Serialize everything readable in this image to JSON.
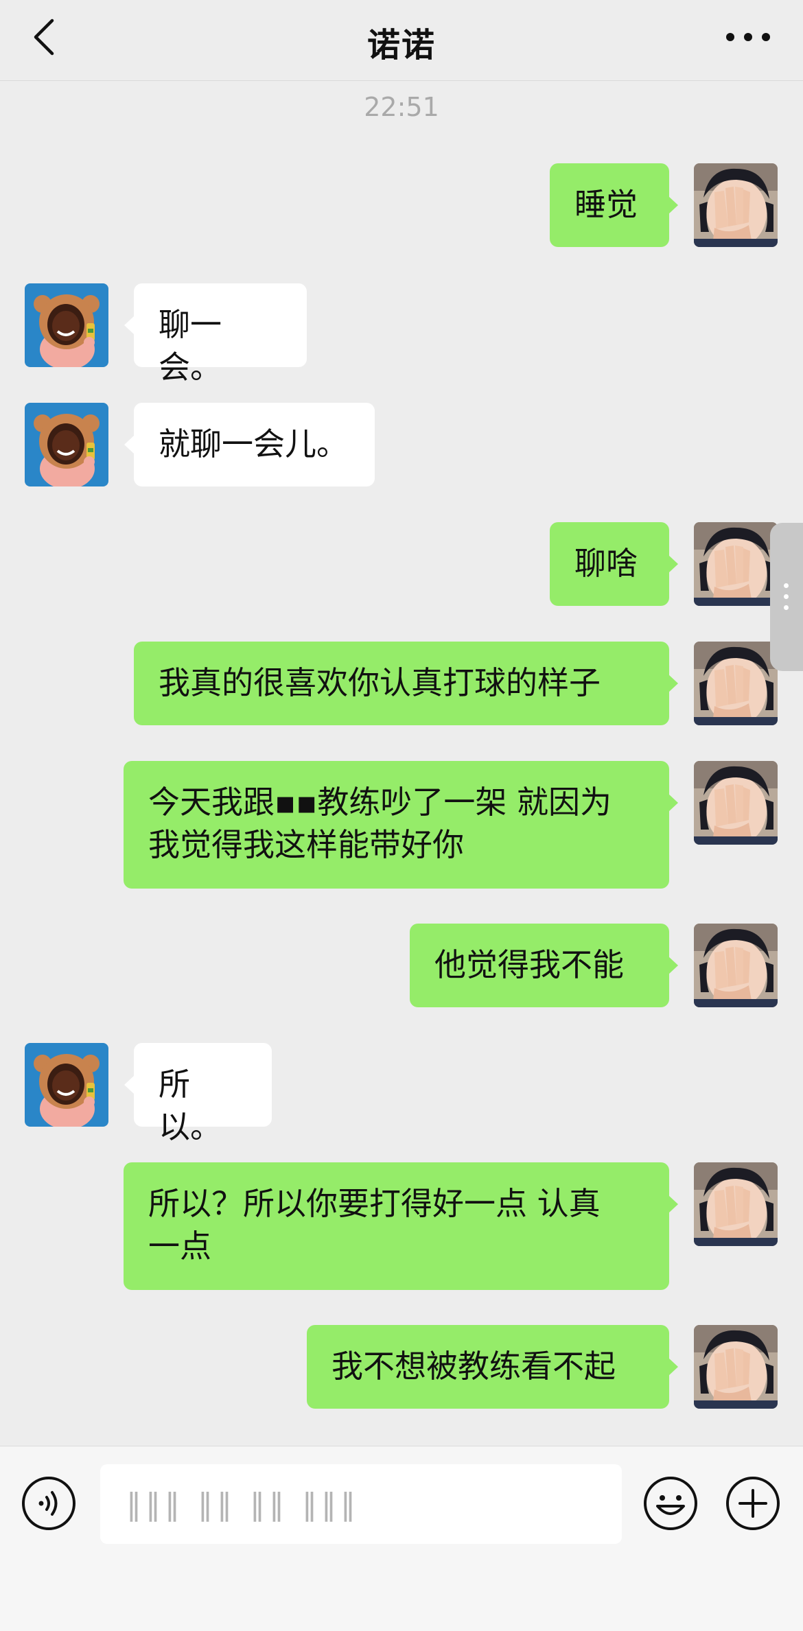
{
  "header": {
    "title": "诺诺",
    "back_icon": "chevron-left-icon",
    "more_icon": "more-dots-icon"
  },
  "timestamp": "22:51",
  "messages": [
    {
      "sender": "me",
      "text": "睡觉"
    },
    {
      "sender": "them",
      "text": "聊一会。"
    },
    {
      "sender": "them",
      "text": "就聊一会儿。"
    },
    {
      "sender": "me",
      "text": "聊啥"
    },
    {
      "sender": "me",
      "text": "我真的很喜欢你认真打球的样子"
    },
    {
      "sender": "me",
      "text": "今天我跟▪▪教练吵了一架 就因为\n我觉得我这样能带好你"
    },
    {
      "sender": "me",
      "text": "他觉得我不能"
    },
    {
      "sender": "them",
      "text": "所以。"
    },
    {
      "sender": "me",
      "text": "所以？所以你要打得好一点 认真\n一点"
    },
    {
      "sender": "me",
      "text": "我不想被教练看不起"
    }
  ],
  "input_bar": {
    "draft_text": "‖‖‖ ‖‖ ‖‖ ‖‖‖",
    "voice_icon": "voice-icon",
    "emoji_icon": "emoji-icon",
    "plus_icon": "plus-icon"
  },
  "colors": {
    "background": "#ededed",
    "my_bubble": "#95ec69",
    "their_bubble": "#ffffff",
    "timestamp": "#a9a9a9"
  }
}
